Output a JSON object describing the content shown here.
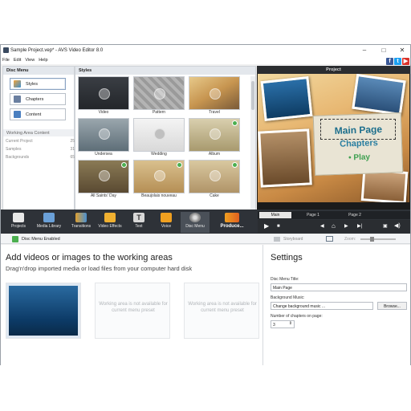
{
  "window": {
    "title": "Sample Project.vep* - AVS Video Editor 8.0"
  },
  "menu": {
    "items": [
      "File",
      "Edit",
      "View",
      "Help"
    ]
  },
  "left_panel": {
    "header": "Disc Menu",
    "buttons": [
      "Styles",
      "Chapters",
      "Content"
    ],
    "working_area_header": "Working Area Content",
    "working_area_items": [
      {
        "label": "Current Project",
        "count": "25"
      },
      {
        "label": "Samples",
        "count": "31"
      },
      {
        "label": "Backgrounds",
        "count": "65"
      }
    ]
  },
  "styles_panel": {
    "header": "Styles",
    "tiles": [
      "Video",
      "Pattern",
      "Travel",
      "Undersea",
      "Wedding",
      "Album",
      "All Saints' Day",
      "Beaujolais nouveau",
      "Cake"
    ]
  },
  "preview": {
    "header": "Project",
    "menu_title": "Main Page",
    "chapters": "Chapters",
    "play": "• Play",
    "page_tabs": [
      "Main",
      "Page 1",
      "Page 2"
    ]
  },
  "tabs": {
    "items": [
      "Projects",
      "Media Library",
      "Transitions",
      "Video Effects",
      "Text",
      "Voice",
      "Disc Menu"
    ],
    "produce": "Produce..."
  },
  "toolbar2": {
    "disc_menu_enabled": "Disc Menu Enabled",
    "storyboard": "Storyboard",
    "zoom": "Zoom:"
  },
  "work": {
    "title": "Add videos or images to the working areas",
    "subtitle": "Drag'n'drop imported media or load files from your computer hard disk",
    "area_msg": "Working area is not available for current menu preset"
  },
  "settings": {
    "title": "Settings",
    "menu_title_label": "Disc Menu Title:",
    "menu_title_value": "Main Page",
    "music_label": "Background Music:",
    "music_value": "Change background music ...",
    "browse": "Browse...",
    "chapters_label": "Number of chapters on page:",
    "chapters_value": "3"
  },
  "colors": {
    "accent": "#4caf50",
    "dark_bar": "#2e3238",
    "title_blue": "#1c6e8c"
  }
}
